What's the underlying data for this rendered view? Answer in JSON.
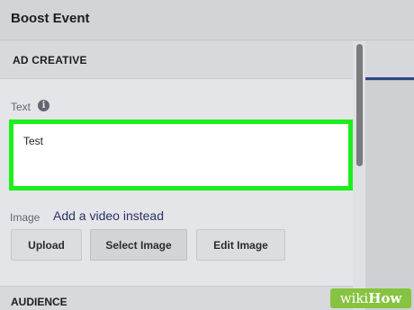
{
  "header": {
    "title": "Boost Event"
  },
  "ad_creative": {
    "section_label": "AD CREATIVE"
  },
  "text_field": {
    "label": "Text",
    "info_icon": "info-icon",
    "value": "Test",
    "highlight_color": "#1bf01b"
  },
  "image_field": {
    "label": "Image",
    "video_link": "Add a video instead",
    "buttons": {
      "upload": "Upload",
      "select": "Select Image",
      "edit": "Edit Image"
    }
  },
  "audience": {
    "section_label": "AUDIENCE"
  },
  "watermark": {
    "wiki": "wiki",
    "how": "How"
  },
  "colors": {
    "accent_blue": "#2f4687",
    "link": "#2a3266"
  }
}
